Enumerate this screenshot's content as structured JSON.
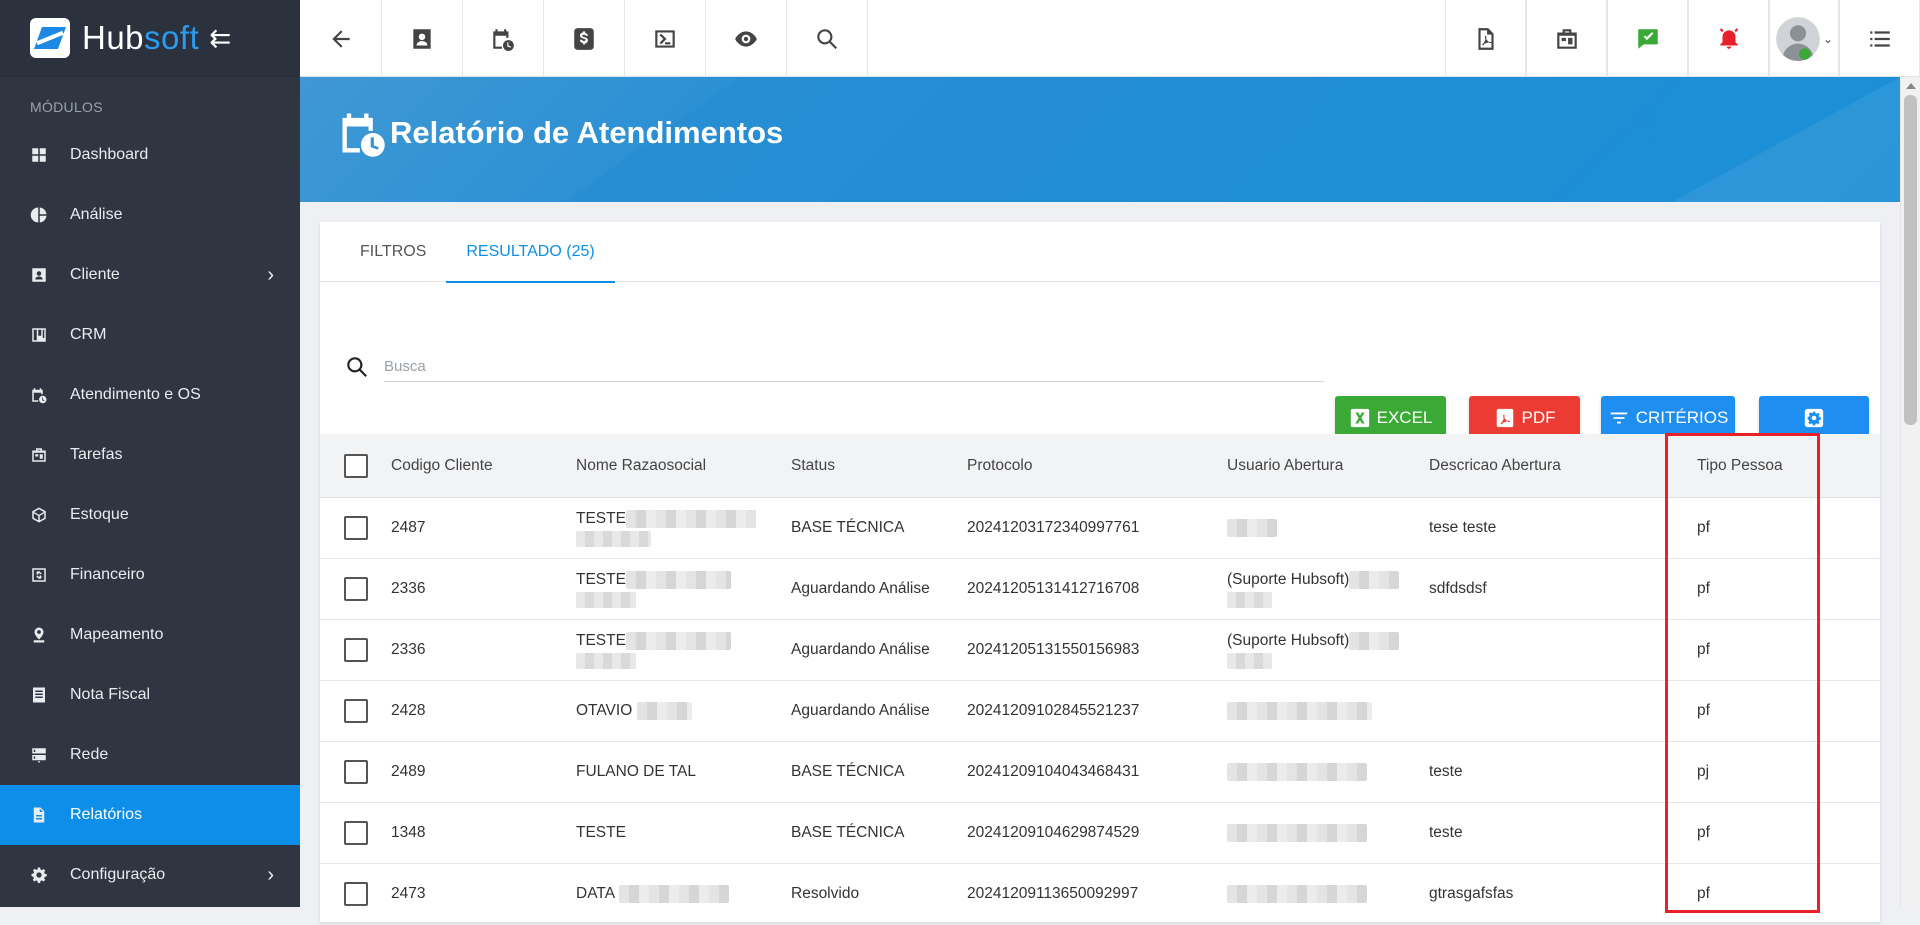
{
  "brand": {
    "name_part1": "Hub",
    "name_part2": "soft"
  },
  "sidebar": {
    "section_title": "MÓDULOS",
    "items": [
      {
        "label": "Dashboard"
      },
      {
        "label": "Análise"
      },
      {
        "label": "Cliente"
      },
      {
        "label": "CRM"
      },
      {
        "label": "Atendimento e OS"
      },
      {
        "label": "Tarefas"
      },
      {
        "label": "Estoque"
      },
      {
        "label": "Financeiro"
      },
      {
        "label": "Mapeamento"
      },
      {
        "label": "Nota Fiscal"
      },
      {
        "label": "Rede"
      },
      {
        "label": "Relatórios"
      },
      {
        "label": "Configuração"
      }
    ]
  },
  "page": {
    "title": "Relatório de Atendimentos"
  },
  "tabs": {
    "filtros": "FILTROS",
    "resultado": "RESULTADO (25)"
  },
  "search": {
    "placeholder": "Busca"
  },
  "buttons": {
    "excel": "EXCEL",
    "pdf": "PDF",
    "criterios": "CRITÉRIOS"
  },
  "table": {
    "headers": {
      "codigo": "Codigo Cliente",
      "nome": "Nome Razaosocial",
      "status": "Status",
      "protocolo": "Protocolo",
      "usuario": "Usuario Abertura",
      "descricao": "Descricao Abertura",
      "tipo": "Tipo Pessoa"
    },
    "rows": [
      {
        "codigo": "2487",
        "nome": "TESTE",
        "status": "BASE TÉCNICA",
        "protocolo": "20241203172340997761",
        "usuario": "",
        "descricao": "tese teste",
        "tipo": "pf"
      },
      {
        "codigo": "2336",
        "nome": "TESTE",
        "status": "Aguardando Análise",
        "protocolo": "20241205131412716708",
        "usuario": "(Suporte Hubsoft)",
        "descricao": "sdfdsdsf",
        "tipo": "pf"
      },
      {
        "codigo": "2336",
        "nome": "TESTE",
        "status": "Aguardando Análise",
        "protocolo": "20241205131550156983",
        "usuario": "(Suporte Hubsoft)",
        "descricao": "",
        "tipo": "pf"
      },
      {
        "codigo": "2428",
        "nome": "OTAVIO",
        "status": "Aguardando Análise",
        "protocolo": "20241209102845521237",
        "usuario": "",
        "descricao": "",
        "tipo": "pf"
      },
      {
        "codigo": "2489",
        "nome": "FULANO DE TAL",
        "status": "BASE TÉCNICA",
        "protocolo": "20241209104043468431",
        "usuario": "",
        "descricao": "teste",
        "tipo": "pj"
      },
      {
        "codigo": "1348",
        "nome": "TESTE",
        "status": "BASE TÉCNICA",
        "protocolo": "20241209104629874529",
        "usuario": "",
        "descricao": "teste",
        "tipo": "pf"
      },
      {
        "codigo": "2473",
        "nome": "DATA",
        "status": "Resolvido",
        "protocolo": "20241209113650092997",
        "usuario": "",
        "descricao": "gtrasgafsfas",
        "tipo": "pf"
      }
    ]
  },
  "colors": {
    "sidebar_bg": "#2f3541",
    "active": "#0d8ee8",
    "excel": "#3aa935",
    "pdf": "#ec3b33",
    "criterios": "#1e8ff0",
    "highlight": "#e8202a"
  }
}
